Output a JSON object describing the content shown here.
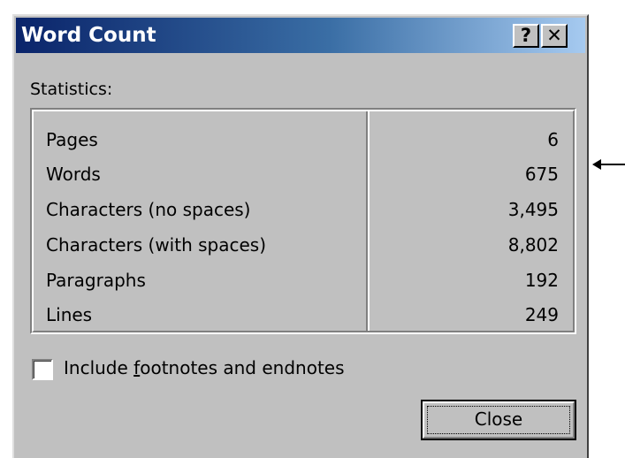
{
  "window": {
    "title": "Word Count",
    "help_label": "?",
    "close_label": "✕"
  },
  "statistics": {
    "label": "Statistics:",
    "rows": [
      {
        "label": "Pages",
        "value": "6"
      },
      {
        "label": "Words",
        "value": "675"
      },
      {
        "label": "Characters (no spaces)",
        "value": "3,495"
      },
      {
        "label": "Characters (with spaces)",
        "value": "8,802"
      },
      {
        "label": "Paragraphs",
        "value": "192"
      },
      {
        "label": "Lines",
        "value": "249"
      }
    ]
  },
  "options": {
    "include_footnotes_pre": "Include ",
    "include_footnotes_mnemonic": "f",
    "include_footnotes_post": "ootnotes and endnotes",
    "include_footnotes_checked": false
  },
  "buttons": {
    "close": "Close"
  },
  "colors": {
    "titlebar_start": "#0a246a",
    "titlebar_end": "#a6caf0",
    "face": "#c0c0c0"
  },
  "icons": {
    "annotation": "left-arrow-icon"
  }
}
